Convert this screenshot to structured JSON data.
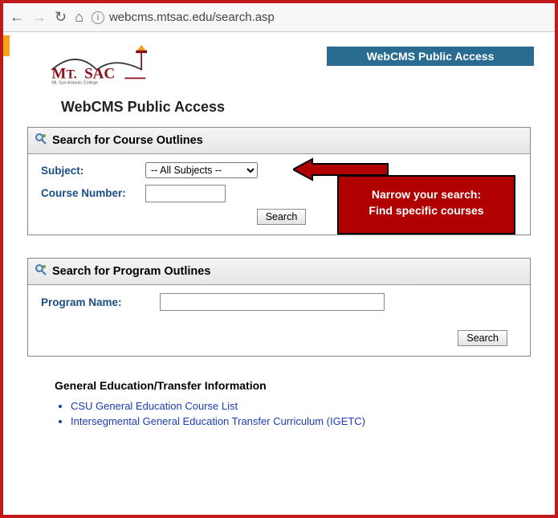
{
  "browser": {
    "url": "webcms.mtsac.edu/search.asp"
  },
  "logo": {
    "main": "MT. SAC",
    "sub": "Mt. San Antonio College"
  },
  "banner": {
    "label": "WebCMS Public Access"
  },
  "page": {
    "title": "WebCMS Public Access"
  },
  "coursePanel": {
    "header": "Search for Course Outlines",
    "subject_label": "Subject:",
    "subject_selected": "-- All Subjects --",
    "course_label": "Course Number:",
    "course_value": "",
    "search_label": "Search"
  },
  "callout": {
    "line1": "Narrow your search:",
    "line2": "Find specific courses"
  },
  "programPanel": {
    "header": "Search for Program Outlines",
    "name_label": "Program Name:",
    "name_value": "",
    "search_label": "Search"
  },
  "ge": {
    "title": "General Education/Transfer Information",
    "links": [
      "CSU General Education Course List",
      "Intersegmental General Education Transfer Curriculum (IGETC)"
    ]
  }
}
